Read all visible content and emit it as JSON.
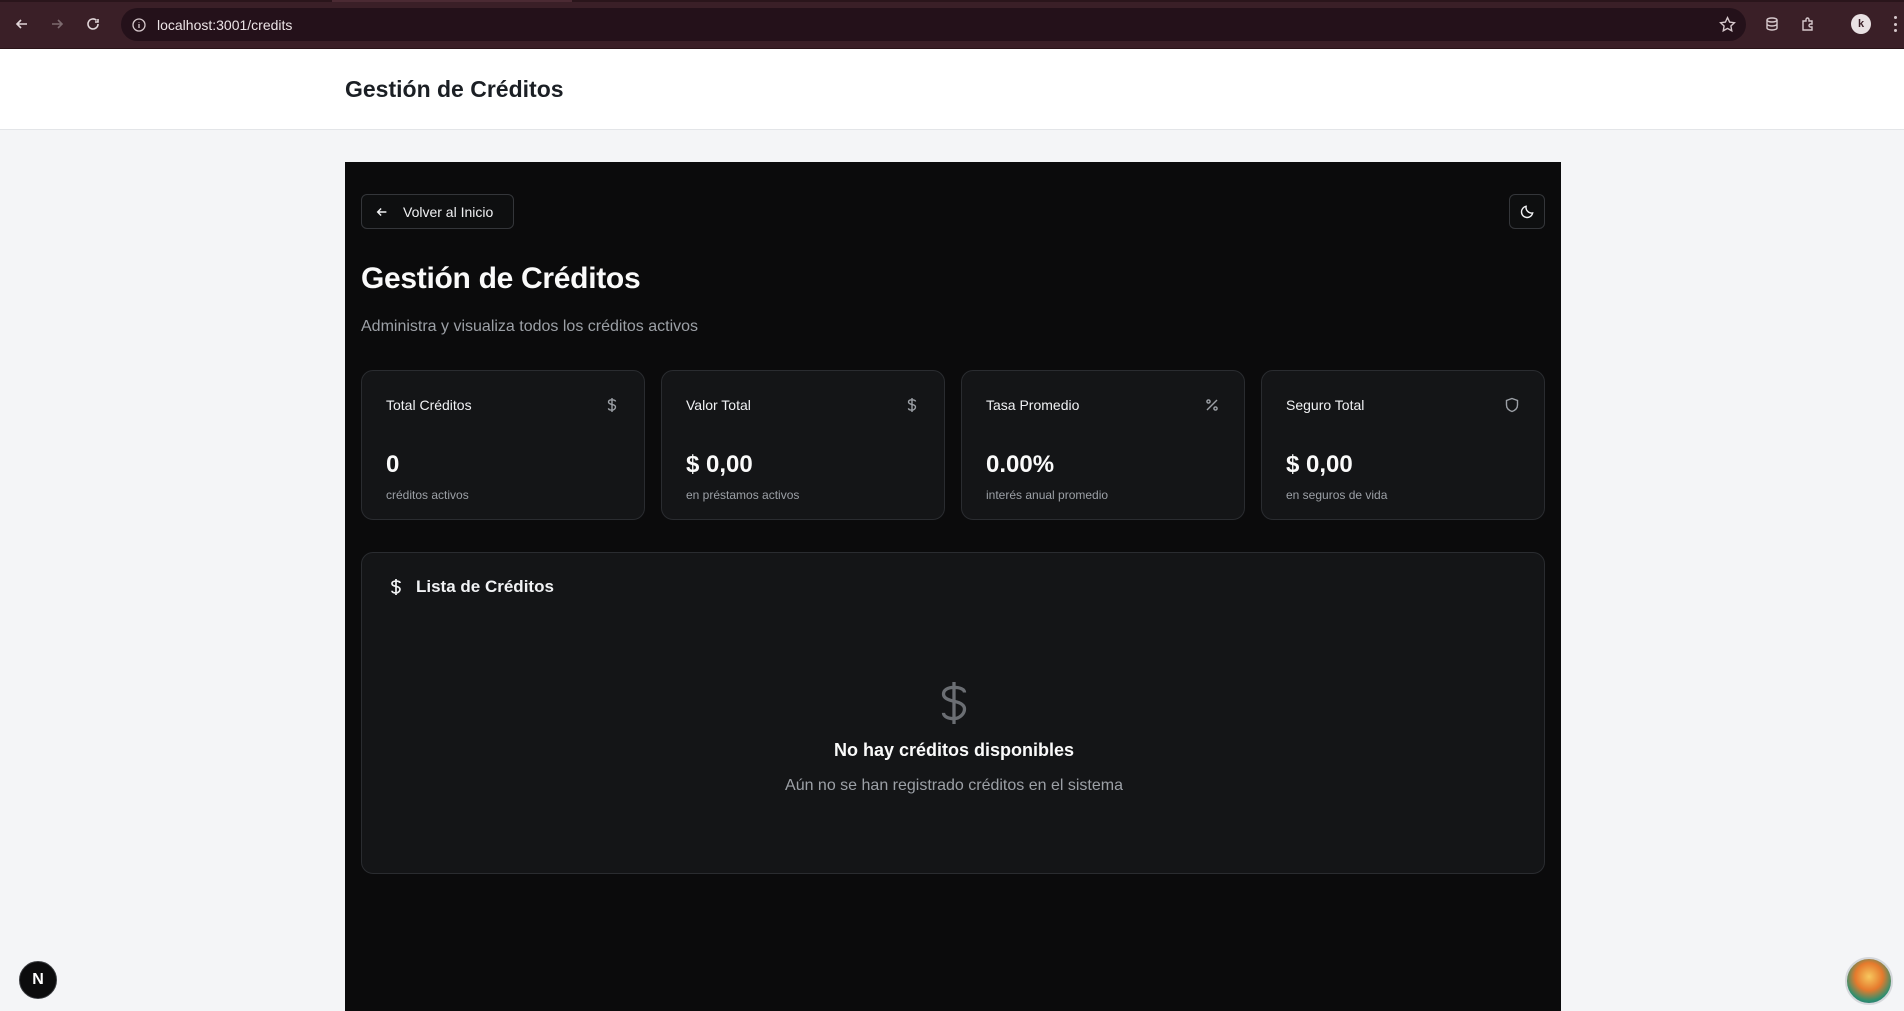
{
  "browser": {
    "url": "localhost:3001/credits",
    "profile_initial": "k"
  },
  "header": {
    "title": "Gestión de Créditos"
  },
  "page": {
    "back_label": "Volver al Inicio",
    "title": "Gestión de Créditos",
    "subtitle": "Administra y visualiza todos los créditos activos"
  },
  "stats": [
    {
      "label": "Total Créditos",
      "icon": "dollar-icon",
      "value": "0",
      "caption": "créditos activos"
    },
    {
      "label": "Valor Total",
      "icon": "dollar-icon",
      "value": "$ 0,00",
      "caption": "en préstamos activos"
    },
    {
      "label": "Tasa Promedio",
      "icon": "percent-icon",
      "value": "0.00%",
      "caption": "interés anual promedio"
    },
    {
      "label": "Seguro Total",
      "icon": "shield-icon",
      "value": "$ 0,00",
      "caption": "en seguros de vida"
    }
  ],
  "credit_list": {
    "title": "Lista de Créditos",
    "empty_title": "No hay créditos disponibles",
    "empty_subtitle": "Aún no se han registrado créditos en el sistema"
  },
  "floating": {
    "next_badge": "N"
  },
  "colors": {
    "chrome_bg": "#3a1f27",
    "panel_bg": "#0b0b0c",
    "card_bg": "#141517",
    "card_border": "#2a2c30",
    "page_bg": "#f4f5f7"
  }
}
